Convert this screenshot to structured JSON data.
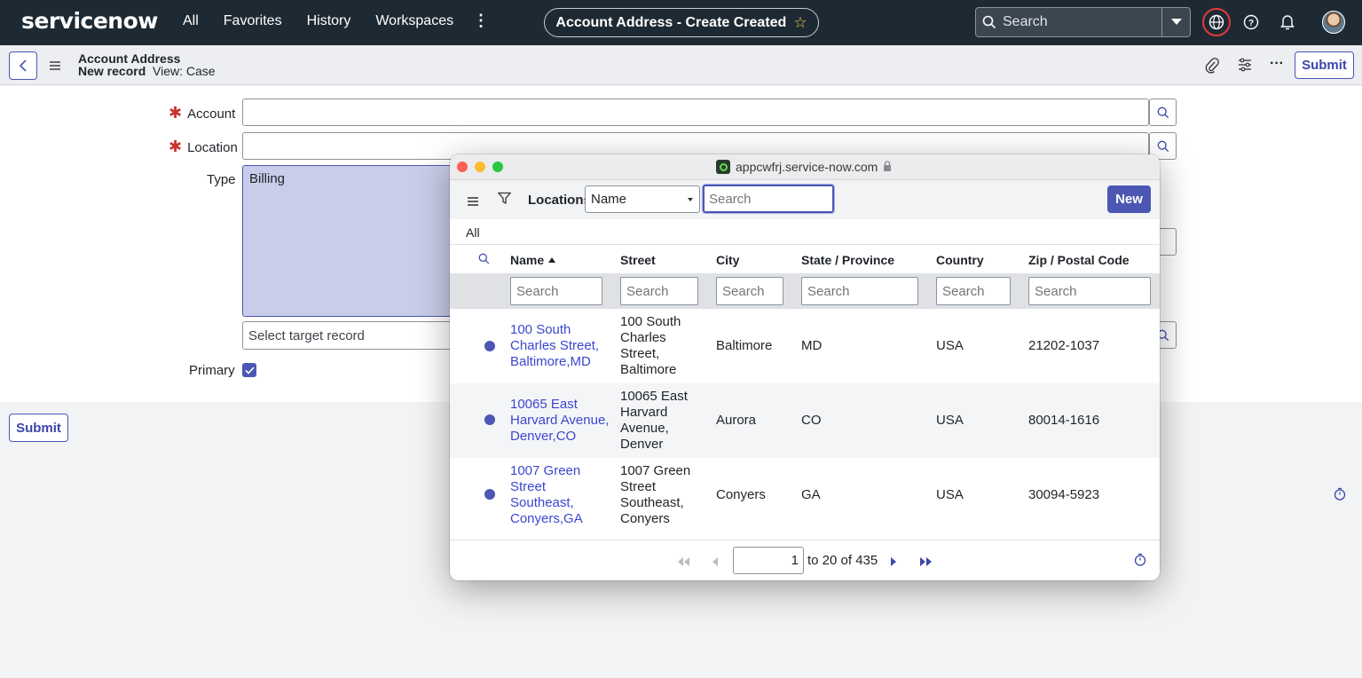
{
  "topnav": {
    "logo": "servicenow",
    "links": [
      "All",
      "Favorites",
      "History",
      "Workspaces"
    ],
    "record_title": "Account Address - Create Created",
    "search_placeholder": "Search"
  },
  "record_header": {
    "title": "Account Address",
    "subtitle_bold": "New record",
    "subtitle_view": "View: Case",
    "submit_label": "Submit"
  },
  "form": {
    "account_label": "Account",
    "location_label": "Location",
    "type_label": "Type",
    "type_value": "Billing",
    "target_placeholder": "Select target record",
    "primary_label": "Primary",
    "primary_checked": true,
    "submit_label": "Submit"
  },
  "popup": {
    "url": "appcwfrj.service-now.com",
    "list_label": "Locations",
    "field_select": "Name",
    "search_placeholder": "Search",
    "new_label": "New",
    "breadcrumb": "All",
    "columns": [
      "Name",
      "Street",
      "City",
      "State / Province",
      "Country",
      "Zip / Postal Code"
    ],
    "filter_placeholder": "Search",
    "rows": [
      {
        "name": [
          "100 South",
          "Charles Street,",
          "Baltimore,MD"
        ],
        "street": [
          "100 South",
          "Charles",
          "Street,",
          "Baltimore"
        ],
        "city": "Baltimore",
        "state": "MD",
        "country": "USA",
        "zip": "21202-1037"
      },
      {
        "name": [
          "10065 East",
          "Harvard Avenue,",
          "Denver,CO"
        ],
        "street": [
          "10065 East",
          "Harvard",
          "Avenue,",
          "Denver"
        ],
        "city": "Aurora",
        "state": "CO",
        "country": "USA",
        "zip": "80014-1616"
      },
      {
        "name": [
          "1007 Green",
          "Street",
          "Southeast,",
          "Conyers,GA"
        ],
        "street": [
          "1007 Green",
          "Street",
          "Southeast,",
          "Conyers"
        ],
        "city": "Conyers",
        "state": "GA",
        "country": "USA",
        "zip": "30094-5923"
      }
    ],
    "pagination": {
      "page": "1",
      "range_text": "to 20 of 435"
    }
  },
  "colors": {
    "nav_bg": "#1e2a33",
    "accent": "#4b57b3",
    "link": "#3b47d0",
    "required": "#c8332e"
  }
}
